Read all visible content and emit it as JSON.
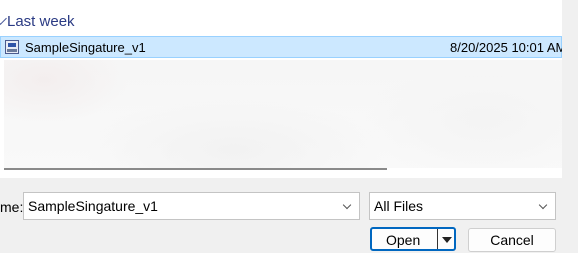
{
  "file_list": {
    "group_header": "Last week",
    "files": [
      {
        "name": "SampleSingature_v1",
        "date_modified": "8/20/2025 10:01 AM",
        "icon": "image-file-icon"
      }
    ]
  },
  "footer": {
    "file_name_label": "me:",
    "file_name_value": "SampleSingature_v1",
    "file_type_value": "All Files",
    "open_label": "Open",
    "cancel_label": "Cancel"
  }
}
